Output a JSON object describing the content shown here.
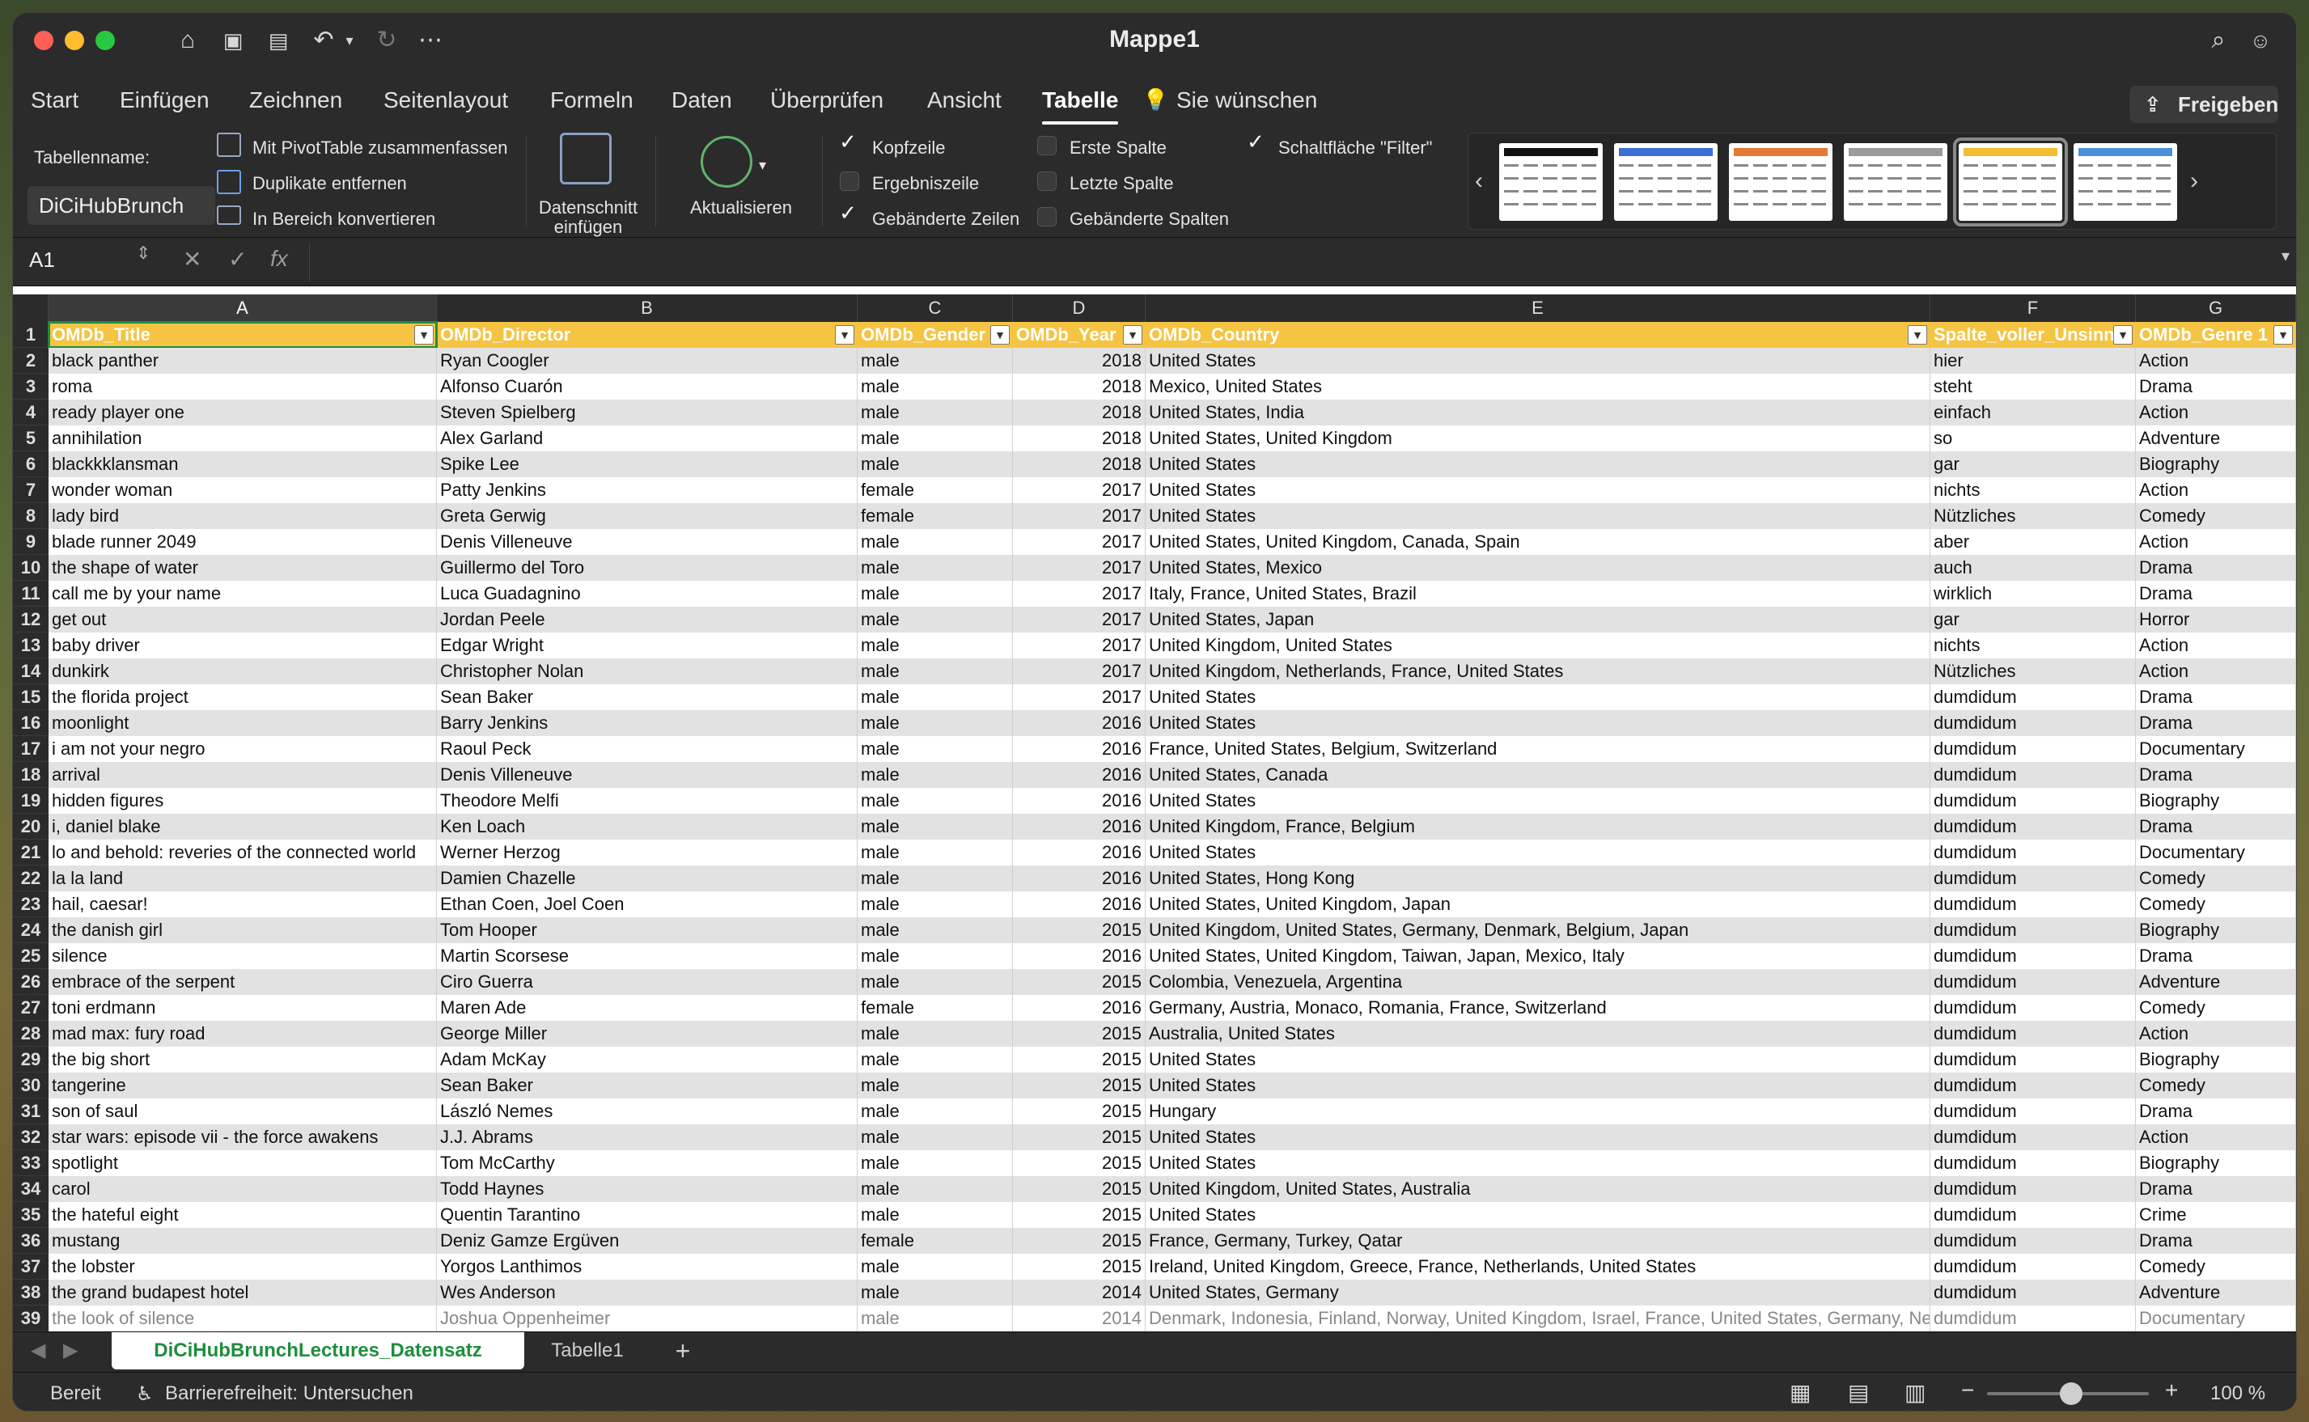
{
  "window": {
    "title": "Mappe1"
  },
  "ribbon_tabs": [
    "Start",
    "Einfügen",
    "Zeichnen",
    "Seitenlayout",
    "Formeln",
    "Daten",
    "Überprüfen",
    "Ansicht",
    "Tabelle",
    "Sie wünschen"
  ],
  "active_tab": "Tabelle",
  "share_label": "Freigeben",
  "ribbon": {
    "table_name_label": "Tabellenname:",
    "table_name_value": "DiCiHubBrunch",
    "pivot_label": "Mit PivotTable zusammenfassen",
    "remove_dupes_label": "Duplikate entfernen",
    "convert_label": "In Bereich konvertieren",
    "slicer_label_1": "Datenschnitt",
    "slicer_label_2": "einfügen",
    "refresh_label": "Aktualisieren",
    "options": [
      {
        "label": "Kopfzeile",
        "checked": true
      },
      {
        "label": "Ergebniszeile",
        "checked": false
      },
      {
        "label": "Gebänderte Zeilen",
        "checked": true
      },
      {
        "label": "Erste Spalte",
        "checked": false
      },
      {
        "label": "Letzte Spalte",
        "checked": false
      },
      {
        "label": "Gebänderte Spalten",
        "checked": false
      },
      {
        "label": "Schaltfläche \"Filter\"",
        "checked": true
      }
    ],
    "table_styles": [
      {
        "color": "#111111"
      },
      {
        "color": "#3b6fd6"
      },
      {
        "color": "#e47a36"
      },
      {
        "color": "#9a9a9a"
      },
      {
        "color": "#f2be2e"
      },
      {
        "color": "#4a90d9"
      }
    ]
  },
  "formula_bar": {
    "cell_ref": "A1",
    "fx": "fx",
    "value": ""
  },
  "columns": [
    "A",
    "B",
    "C",
    "D",
    "E",
    "F",
    "G"
  ],
  "header_row": [
    "OMDb_Title",
    "OMDb_Director",
    "OMDb_Gender",
    "OMDb_Year",
    "OMDb_Country",
    "Spalte_voller_Unsinn",
    "OMDb_Genre 1"
  ],
  "rows": [
    [
      "black panther",
      "Ryan Coogler",
      "male",
      "2018",
      "United States",
      "hier",
      "Action"
    ],
    [
      "roma",
      "Alfonso Cuarón",
      "male",
      "2018",
      "Mexico, United States",
      "steht",
      "Drama"
    ],
    [
      "ready player one",
      "Steven Spielberg",
      " male",
      "2018",
      "United States, India",
      "einfach",
      "Action"
    ],
    [
      "annihilation",
      "Alex Garland",
      "male",
      "2018",
      "United States, United Kingdom",
      "so",
      "Adventure"
    ],
    [
      "blackkklansman",
      "Spike Lee",
      "male",
      "2018",
      "United States",
      "gar",
      "Biography"
    ],
    [
      "wonder woman",
      "Patty Jenkins",
      "female",
      "2017",
      "United States",
      "nichts",
      "Action"
    ],
    [
      "lady bird",
      "Greta Gerwig",
      "female",
      "2017",
      "United States",
      "Nützliches",
      "Comedy"
    ],
    [
      "blade runner 2049",
      "Denis Villeneuve",
      "male",
      "2017",
      "United States, United Kingdom, Canada, Spain",
      "aber",
      "Action"
    ],
    [
      "the shape of water",
      "Guillermo del Toro",
      "male",
      "2017",
      "United States, Mexico",
      "auch",
      "Drama"
    ],
    [
      "call me by your name",
      "Luca Guadagnino",
      "male",
      "2017",
      "Italy, France, United States, Brazil",
      "wirklich",
      "Drama"
    ],
    [
      "get out",
      "Jordan Peele",
      "male",
      "2017",
      "United States, Japan",
      "gar",
      "Horror"
    ],
    [
      "baby driver",
      "Edgar Wright",
      "male",
      "2017",
      "United Kingdom, United States",
      "nichts",
      "Action"
    ],
    [
      "dunkirk",
      "Christopher Nolan",
      " male",
      "2017",
      "United Kingdom, Netherlands, France, United States",
      "Nützliches",
      "Action"
    ],
    [
      "the florida project",
      "Sean Baker",
      "male",
      "2017",
      "United States",
      "dumdidum",
      "Drama"
    ],
    [
      "moonlight",
      "Barry Jenkins",
      "male",
      "2016",
      "United States",
      "dumdidum",
      "Drama"
    ],
    [
      "i am not your negro",
      "Raoul Peck",
      "male",
      "2016",
      "France, United States, Belgium, Switzerland",
      "dumdidum",
      "Documentary"
    ],
    [
      "arrival",
      "Denis Villeneuve",
      "male",
      "2016",
      "United States, Canada",
      "dumdidum",
      "Drama"
    ],
    [
      "hidden figures",
      "Theodore Melfi",
      "male",
      "2016",
      "United States",
      "dumdidum",
      "Biography"
    ],
    [
      "i, daniel blake",
      "Ken Loach",
      " male",
      "2016",
      "United Kingdom, France, Belgium",
      "dumdidum",
      "Drama"
    ],
    [
      "lo and behold: reveries of the connected world",
      "Werner Herzog",
      "male",
      "2016",
      "United States",
      "dumdidum",
      "Documentary"
    ],
    [
      "la la land",
      "Damien Chazelle",
      "male",
      "2016",
      "United States, Hong Kong",
      "dumdidum",
      "Comedy"
    ],
    [
      "hail, caesar!",
      "Ethan Coen, Joel Coen",
      "male",
      "2016",
      "United States, United Kingdom, Japan",
      "dumdidum",
      "Comedy"
    ],
    [
      "the danish girl",
      "Tom Hooper",
      "male",
      "2015",
      "United Kingdom, United States, Germany, Denmark, Belgium, Japan",
      "dumdidum",
      "Biography"
    ],
    [
      "silence",
      "Martin Scorsese",
      "male",
      "2016",
      "United States, United Kingdom, Taiwan, Japan, Mexico, Italy",
      "dumdidum",
      "Drama"
    ],
    [
      "embrace of the serpent",
      "Ciro Guerra",
      "male",
      "2015",
      "Colombia, Venezuela, Argentina",
      "dumdidum",
      "Adventure"
    ],
    [
      "toni erdmann",
      "Maren Ade",
      "female",
      "2016",
      "Germany, Austria, Monaco, Romania, France, Switzerland",
      "dumdidum",
      "Comedy"
    ],
    [
      "mad max: fury road",
      "George Miller",
      "male",
      "2015",
      "Australia, United States",
      "dumdidum",
      "Action"
    ],
    [
      "the big short",
      "Adam McKay",
      "male",
      "2015",
      "United States",
      "dumdidum",
      "Biography"
    ],
    [
      "tangerine",
      "Sean Baker",
      "male",
      "2015",
      "United States",
      "dumdidum",
      "Comedy"
    ],
    [
      "son of saul",
      "László Nemes",
      "male",
      "2015",
      "Hungary",
      "dumdidum",
      "Drama"
    ],
    [
      "star wars: episode vii - the force awakens",
      "J.J. Abrams",
      "male",
      "2015",
      "United States",
      "dumdidum",
      "Action"
    ],
    [
      "spotlight",
      "Tom McCarthy",
      " male",
      "2015",
      "United States",
      "dumdidum",
      "Biography"
    ],
    [
      "carol",
      "Todd Haynes",
      " male",
      "2015",
      "United Kingdom, United States, Australia",
      "dumdidum",
      "Drama"
    ],
    [
      "the hateful eight",
      "Quentin Tarantino",
      "male",
      "2015",
      "United States",
      "dumdidum",
      "Crime"
    ],
    [
      "mustang",
      "Deniz Gamze Ergüven",
      "female",
      "2015",
      "France, Germany, Turkey, Qatar",
      "dumdidum",
      "Drama"
    ],
    [
      "the lobster",
      "Yorgos Lanthimos",
      "male",
      "2015",
      "Ireland, United Kingdom, Greece, France, Netherlands, United States",
      "dumdidum",
      "Comedy"
    ],
    [
      "the grand budapest hotel",
      "Wes Anderson",
      "male",
      "2014",
      "United States, Germany",
      "dumdidum",
      "Adventure"
    ],
    [
      "the look of silence",
      "Joshua Oppenheimer",
      "male",
      "2014",
      "Denmark, Indonesia, Finland, Norway, United Kingdom, Israel, France, United States, Germany, Netherlands",
      "dumdidum",
      "Documentary"
    ]
  ],
  "sheets": [
    "DiCiHubBrunchLectures_Datensatz",
    "Tabelle1"
  ],
  "active_sheet": "DiCiHubBrunchLectures_Datensatz",
  "status": {
    "ready": "Bereit",
    "accessibility": "Barrierefreiheit: Untersuchen",
    "zoom": "100 %"
  }
}
